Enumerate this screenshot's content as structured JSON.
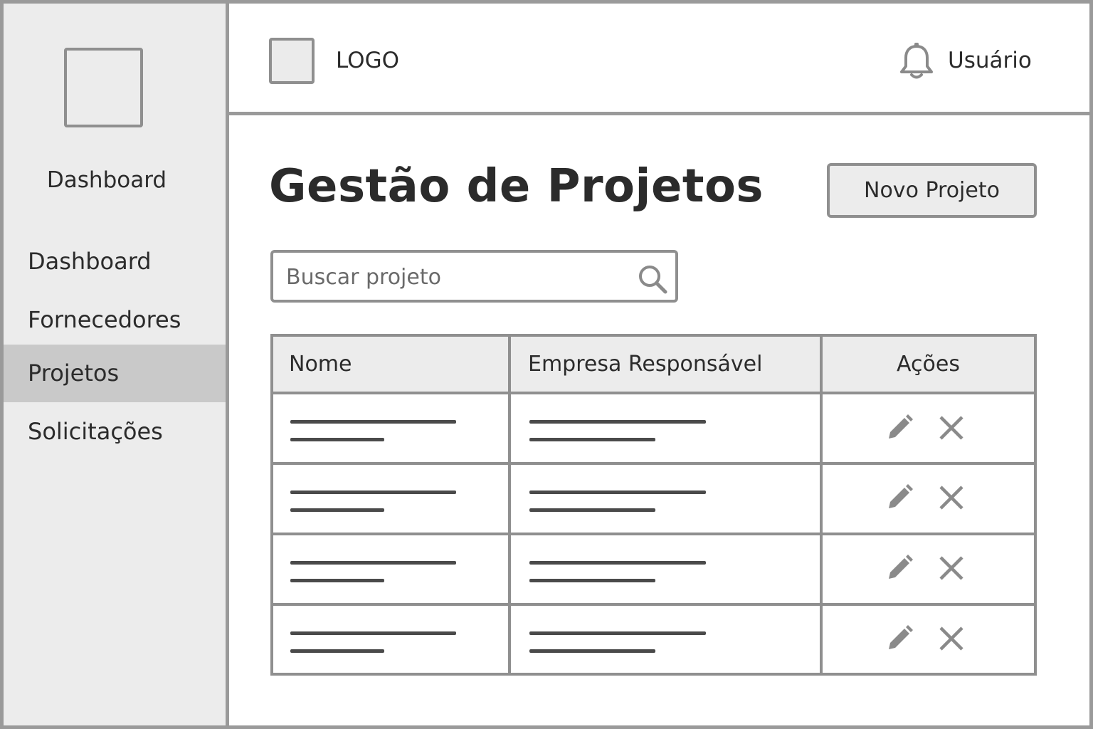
{
  "sidebar": {
    "brand": "Dashboard",
    "items": [
      {
        "label": "Dashboard",
        "active": false
      },
      {
        "label": "Fornecedores",
        "active": false
      },
      {
        "label": "Projetos",
        "active": true
      },
      {
        "label": "Solicitações",
        "active": false
      }
    ]
  },
  "header": {
    "logo_text": "LOGO",
    "notification_icon": "bell-icon",
    "user_label": "Usuário"
  },
  "main": {
    "title": "Gestão de Projetos",
    "new_button_label": "Novo Projeto",
    "search": {
      "placeholder": "Buscar projeto",
      "value": "",
      "icon": "search-icon"
    }
  },
  "table": {
    "columns": [
      "Nome",
      "Empresa Responsável",
      "Ações"
    ],
    "row_count": 4,
    "action_icons": [
      "pencil-icon",
      "close-icon"
    ]
  },
  "colors": {
    "border": "#8f8f8f",
    "sidebar_bg": "#ececec",
    "active_item_bg": "#c9c9c9",
    "text": "#2b2b2b"
  }
}
